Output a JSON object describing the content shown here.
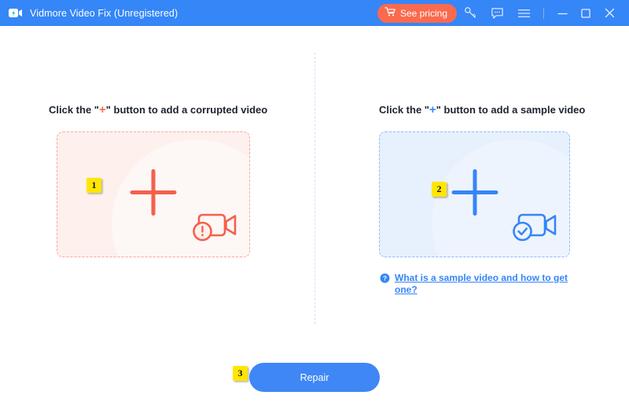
{
  "window": {
    "title": "Vidmore Video Fix (Unregistered)",
    "logo_icon": "video-camera-logo-icon",
    "titlebar_color": "#3586f7"
  },
  "titlebar": {
    "pricing_label": "See pricing",
    "pricing_color": "#fa6a4e",
    "cart_icon": "shopping-cart-icon",
    "key_icon": "key-icon",
    "feedback_icon": "chat-bubble-icon",
    "menu_icon": "hamburger-menu-icon",
    "minimize_icon": "minimize-icon",
    "maximize_icon": "maximize-icon",
    "close_icon": "close-icon"
  },
  "panels": {
    "corrupted": {
      "heading_prefix": "Click the \"",
      "heading_plus": "+",
      "heading_suffix": "\" button to add a corrupted video",
      "badge": "1",
      "accent_color": "#fa6a4e",
      "zone_bg": "#fdf0ed",
      "plus_icon": "plus-icon",
      "status_icon": "video-camera-error-icon"
    },
    "sample": {
      "heading_prefix": "Click the \"",
      "heading_plus": "+",
      "heading_suffix": "\" button to add a sample video",
      "badge": "2",
      "accent_color": "#3586f7",
      "zone_bg": "#e7f0fd",
      "plus_icon": "plus-icon",
      "status_icon": "video-camera-check-icon",
      "help_link": "What is a sample video and how to get one?",
      "help_icon": "question-mark-circle-icon"
    }
  },
  "footer": {
    "repair_label": "Repair",
    "repair_color": "#3f87f5",
    "badge": "3"
  }
}
